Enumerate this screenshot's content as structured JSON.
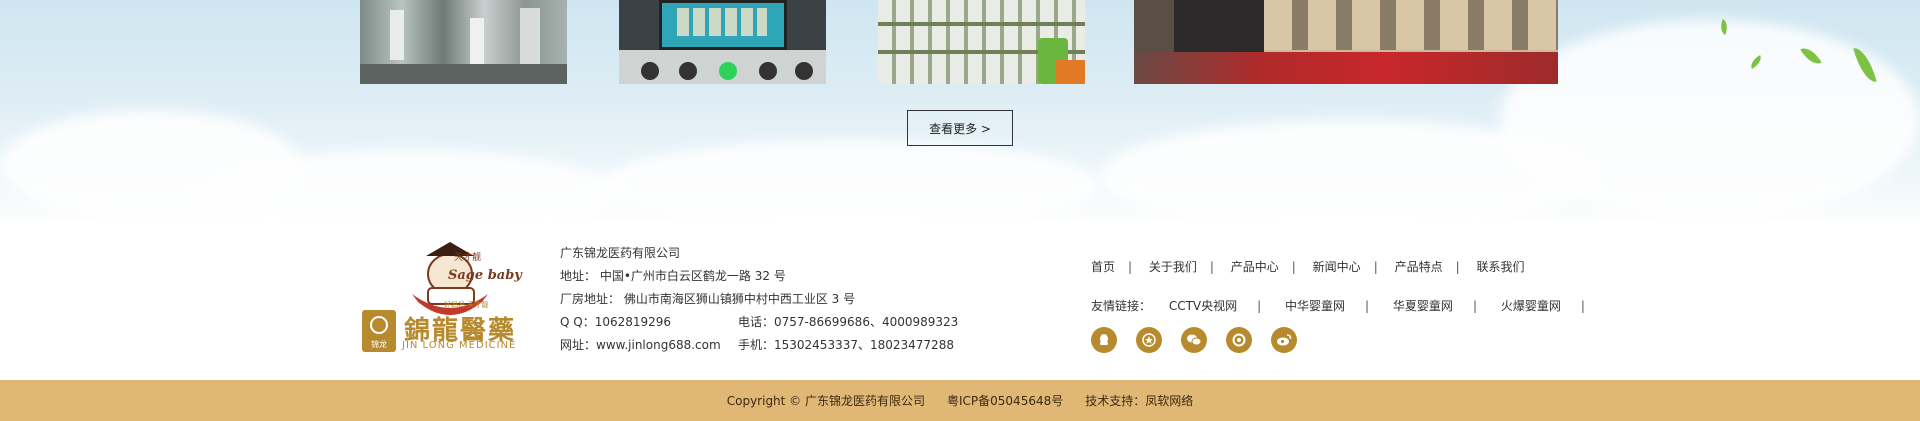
{
  "gallery": {
    "more_label": "查看更多 >"
  },
  "company": {
    "logo_cn": "錦龍醫藥",
    "logo_en": "JIN LONG MEDICINE",
    "logo_small": "锦龙",
    "baby_brand": "Sage baby",
    "baby_cn": "天才靓",
    "baby_slogan": "好妈妈 天才靓",
    "name": "广东锦龙医药有限公司",
    "address": "地址： 中国•广州市白云区鹤龙一路 32 号",
    "factory": "厂房地址： 佛山市南海区狮山镇狮中村中西工业区 3 号",
    "qq": "Q Q：1062819296",
    "phone": "电话：0757-86699686、4000989323",
    "website": "网址：www.jinlong688.com",
    "mobile": "手机：15302453337、18023477288"
  },
  "nav": {
    "items": [
      "首页",
      "关于我们",
      "产品中心",
      "新闻中心",
      "产品特点",
      "联系我们"
    ]
  },
  "friend_links": {
    "label": "友情链接：",
    "items": [
      "CCTV央视网",
      "中华婴童网",
      "华夏婴童网",
      "火爆婴童网"
    ]
  },
  "social": {
    "icons": [
      "qq-icon",
      "star-icon",
      "wechat-icon",
      "camera-icon",
      "weibo-icon"
    ]
  },
  "copyright": {
    "text": "Copyright © 广东锦龙医药有限公司",
    "icp": "粤ICP备05045648号",
    "support": "技术支持：凤软网络"
  },
  "colors": {
    "footer_bar": "#e1b776",
    "brand_gold": "#b88a2e"
  }
}
